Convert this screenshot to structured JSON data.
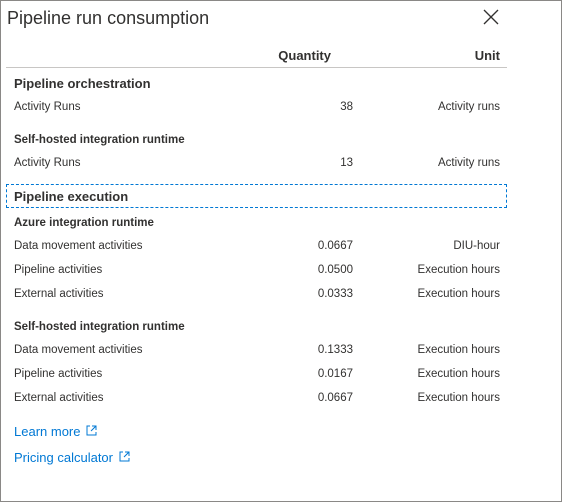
{
  "dialog": {
    "title": "Pipeline run consumption",
    "close_icon": "close-icon"
  },
  "columns": {
    "quantity": "Quantity",
    "unit": "Unit"
  },
  "orchestration": {
    "title": "Pipeline orchestration",
    "groups": [
      {
        "title": "",
        "rows": [
          {
            "label": "Activity Runs",
            "quantity": "38",
            "unit": "Activity runs"
          }
        ]
      },
      {
        "title": "Self-hosted integration runtime",
        "rows": [
          {
            "label": "Activity Runs",
            "quantity": "13",
            "unit": "Activity runs"
          }
        ]
      }
    ]
  },
  "execution": {
    "title": "Pipeline execution",
    "azure": {
      "title": "Azure integration runtime",
      "rows": [
        {
          "label": "Data movement activities",
          "quantity": "0.0667",
          "unit": "DIU-hour"
        },
        {
          "label": "Pipeline activities",
          "quantity": "0.0500",
          "unit": "Execution hours"
        },
        {
          "label": "External activities",
          "quantity": "0.0333",
          "unit": "Execution hours"
        }
      ]
    },
    "selfhosted": {
      "title": "Self-hosted integration runtime",
      "rows": [
        {
          "label": "Data movement activities",
          "quantity": "0.1333",
          "unit": "Execution hours"
        },
        {
          "label": "Pipeline activities",
          "quantity": "0.0167",
          "unit": "Execution hours"
        },
        {
          "label": "External activities",
          "quantity": "0.0667",
          "unit": "Execution hours"
        }
      ]
    }
  },
  "links": {
    "learn_more": "Learn more",
    "pricing_calculator": "Pricing calculator",
    "external_icon": "external-link-icon"
  },
  "colors": {
    "link": "#0078d4",
    "focus_border": "#0078d4",
    "text": "#323130"
  }
}
